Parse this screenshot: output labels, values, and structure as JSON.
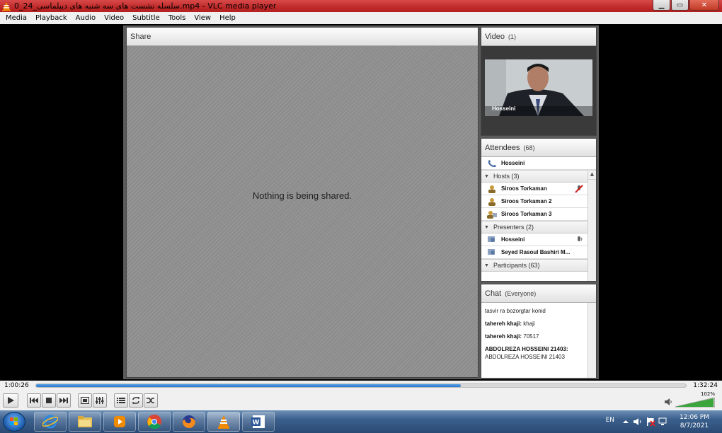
{
  "window": {
    "title": "سلسله نشست های سه شنبه های دیپلماسی_24_0.mp4 - VLC media player",
    "minimize": "▁",
    "maximize": "▭",
    "close": "✕"
  },
  "menu": [
    "Media",
    "Playback",
    "Audio",
    "Video",
    "Subtitle",
    "Tools",
    "View",
    "Help"
  ],
  "share": {
    "title": "Share",
    "message": "Nothing is being shared."
  },
  "video_pane": {
    "title": "Video",
    "count": "(1)",
    "cam_label": "Hosseini"
  },
  "attendees": {
    "title": "Attendees",
    "count": "(68)",
    "current_speaker": "Hosseini",
    "groups": [
      {
        "label": "Hosts (3)",
        "items": [
          "Siroos Torkaman",
          "Siroos Torkaman 2",
          "Siroos Torkaman 3"
        ]
      },
      {
        "label": "Presenters (2)",
        "items": [
          "Hosseini",
          "Seyed Rasoul Bashiri M..."
        ]
      },
      {
        "label": "Participants (63)",
        "items": []
      }
    ]
  },
  "chat": {
    "title": "Chat",
    "scope": "(Everyone)",
    "messages": [
      {
        "sender": "",
        "text": "tasvir ra bozorgtar konid"
      },
      {
        "sender": "tahereh khaji:",
        "text": "khaji"
      },
      {
        "sender": "tahereh khaji:",
        "text": "70517"
      },
      {
        "sender": "ABDOLREZA HOSSEINI 21403:",
        "text": "ABDOLREZA HOSSEINI 21403"
      }
    ]
  },
  "player": {
    "elapsed": "1:00:26",
    "total": "1:32:24",
    "progress_fraction": 0.654,
    "volume": "102%"
  },
  "taskbar": {
    "language": "EN",
    "time": "12:06 PM",
    "date": "8/7/2021"
  },
  "colors": {
    "title_bar": "#c02a2a",
    "seek_fill": "#2b78c9",
    "taskbar": "#3b5f8c"
  }
}
